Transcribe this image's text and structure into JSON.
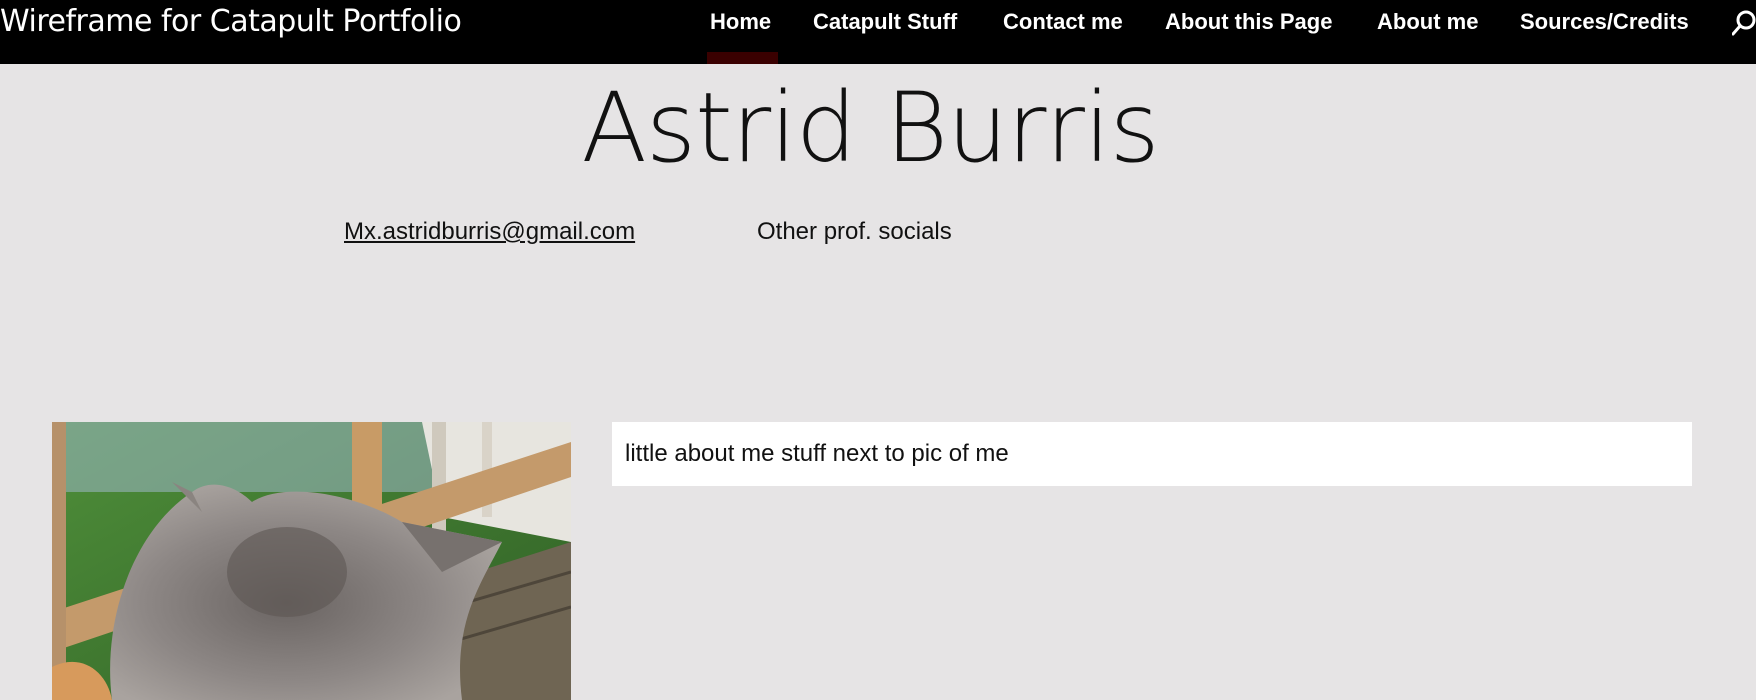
{
  "header": {
    "site_title": "Wireframe for Catapult Portfolio",
    "nav": [
      {
        "label": "Home",
        "active": true
      },
      {
        "label": "Catapult Stuff"
      },
      {
        "label": "Contact me"
      },
      {
        "label": "About this Page"
      },
      {
        "label": "About me"
      },
      {
        "label": "Sources/Credits"
      }
    ],
    "search_icon": "search-icon",
    "colors": {
      "background": "#000000",
      "text": "#ffffff",
      "active_indicator": "#3a0000"
    }
  },
  "main": {
    "name": "Astrid Burris",
    "email": "Mx.astridburris@gmail.com",
    "socials": "Other prof. socials",
    "about_text": "little about me stuff next to pic of me",
    "colors": {
      "page_background": "#e6e4e5",
      "about_box": "#ffffff"
    }
  }
}
